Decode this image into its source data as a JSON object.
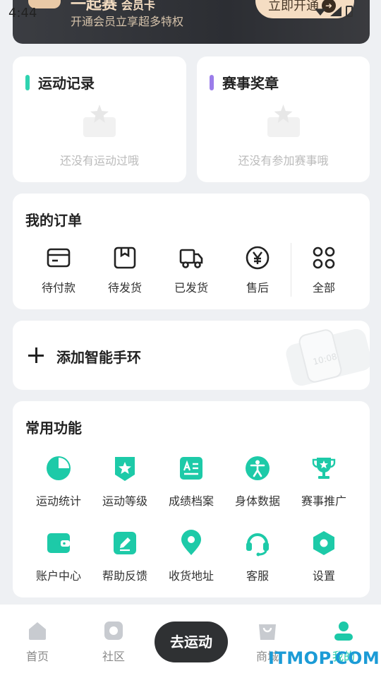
{
  "status_bar": {
    "time": "4:44"
  },
  "banner": {
    "title": "一起赛",
    "title_suffix": "会员卡",
    "subtitle": "开通会员立享超多特权",
    "button_label": "立即开通",
    "accent": "#f5ddc3"
  },
  "sport_record": {
    "title": "运动记录",
    "empty_text": "还没有运动过哦",
    "accent": "#2fd3b0"
  },
  "medals": {
    "title": "赛事奖章",
    "empty_text": "还没有参加赛事哦",
    "accent": "#9b7dea"
  },
  "orders": {
    "title": "我的订单",
    "items": [
      {
        "label": "待付款",
        "icon": "wallet-card-icon"
      },
      {
        "label": "待发货",
        "icon": "package-box-icon"
      },
      {
        "label": "已发货",
        "icon": "delivery-truck-icon"
      },
      {
        "label": "售后",
        "icon": "yen-circle-icon"
      },
      {
        "label": "全部",
        "icon": "grid-icon"
      }
    ]
  },
  "add_device": {
    "label": "添加智能手环",
    "band_time": "10:08"
  },
  "functions": {
    "title": "常用功能",
    "accent": "#1dcaa8",
    "items": [
      {
        "label": "运动统计",
        "icon": "pie-chart-icon"
      },
      {
        "label": "运动等级",
        "icon": "star-shield-icon"
      },
      {
        "label": "成绩档案",
        "icon": "document-icon"
      },
      {
        "label": "身体数据",
        "icon": "person-circle-icon"
      },
      {
        "label": "赛事推广",
        "icon": "trophy-icon"
      },
      {
        "label": "账户中心",
        "icon": "wallet-icon"
      },
      {
        "label": "帮助反馈",
        "icon": "edit-icon"
      },
      {
        "label": "收货地址",
        "icon": "location-pin-icon"
      },
      {
        "label": "客服",
        "icon": "headset-icon"
      },
      {
        "label": "设置",
        "icon": "hexagon-settings-icon"
      }
    ]
  },
  "nav": {
    "items": [
      {
        "label": "首页",
        "icon": "home-icon"
      },
      {
        "label": "社区",
        "icon": "community-icon"
      },
      {
        "label": "商城",
        "icon": "shopping-bag-icon"
      },
      {
        "label": "我的",
        "icon": "profile-icon",
        "active": true
      }
    ],
    "center_button": "去运动",
    "active_color": "#1cc9a8"
  },
  "watermark": "ITMOP.COM"
}
